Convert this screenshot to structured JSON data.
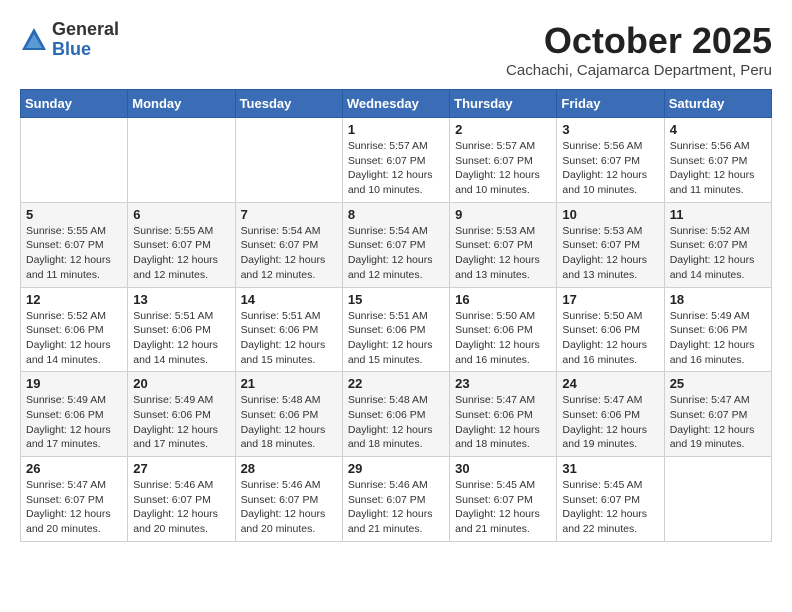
{
  "header": {
    "logo_general": "General",
    "logo_blue": "Blue",
    "month_title": "October 2025",
    "location": "Cachachi, Cajamarca Department, Peru"
  },
  "weekdays": [
    "Sunday",
    "Monday",
    "Tuesday",
    "Wednesday",
    "Thursday",
    "Friday",
    "Saturday"
  ],
  "weeks": [
    [
      {
        "day": "",
        "info": ""
      },
      {
        "day": "",
        "info": ""
      },
      {
        "day": "",
        "info": ""
      },
      {
        "day": "1",
        "info": "Sunrise: 5:57 AM\nSunset: 6:07 PM\nDaylight: 12 hours\nand 10 minutes."
      },
      {
        "day": "2",
        "info": "Sunrise: 5:57 AM\nSunset: 6:07 PM\nDaylight: 12 hours\nand 10 minutes."
      },
      {
        "day": "3",
        "info": "Sunrise: 5:56 AM\nSunset: 6:07 PM\nDaylight: 12 hours\nand 10 minutes."
      },
      {
        "day": "4",
        "info": "Sunrise: 5:56 AM\nSunset: 6:07 PM\nDaylight: 12 hours\nand 11 minutes."
      }
    ],
    [
      {
        "day": "5",
        "info": "Sunrise: 5:55 AM\nSunset: 6:07 PM\nDaylight: 12 hours\nand 11 minutes."
      },
      {
        "day": "6",
        "info": "Sunrise: 5:55 AM\nSunset: 6:07 PM\nDaylight: 12 hours\nand 12 minutes."
      },
      {
        "day": "7",
        "info": "Sunrise: 5:54 AM\nSunset: 6:07 PM\nDaylight: 12 hours\nand 12 minutes."
      },
      {
        "day": "8",
        "info": "Sunrise: 5:54 AM\nSunset: 6:07 PM\nDaylight: 12 hours\nand 12 minutes."
      },
      {
        "day": "9",
        "info": "Sunrise: 5:53 AM\nSunset: 6:07 PM\nDaylight: 12 hours\nand 13 minutes."
      },
      {
        "day": "10",
        "info": "Sunrise: 5:53 AM\nSunset: 6:07 PM\nDaylight: 12 hours\nand 13 minutes."
      },
      {
        "day": "11",
        "info": "Sunrise: 5:52 AM\nSunset: 6:07 PM\nDaylight: 12 hours\nand 14 minutes."
      }
    ],
    [
      {
        "day": "12",
        "info": "Sunrise: 5:52 AM\nSunset: 6:06 PM\nDaylight: 12 hours\nand 14 minutes."
      },
      {
        "day": "13",
        "info": "Sunrise: 5:51 AM\nSunset: 6:06 PM\nDaylight: 12 hours\nand 14 minutes."
      },
      {
        "day": "14",
        "info": "Sunrise: 5:51 AM\nSunset: 6:06 PM\nDaylight: 12 hours\nand 15 minutes."
      },
      {
        "day": "15",
        "info": "Sunrise: 5:51 AM\nSunset: 6:06 PM\nDaylight: 12 hours\nand 15 minutes."
      },
      {
        "day": "16",
        "info": "Sunrise: 5:50 AM\nSunset: 6:06 PM\nDaylight: 12 hours\nand 16 minutes."
      },
      {
        "day": "17",
        "info": "Sunrise: 5:50 AM\nSunset: 6:06 PM\nDaylight: 12 hours\nand 16 minutes."
      },
      {
        "day": "18",
        "info": "Sunrise: 5:49 AM\nSunset: 6:06 PM\nDaylight: 12 hours\nand 16 minutes."
      }
    ],
    [
      {
        "day": "19",
        "info": "Sunrise: 5:49 AM\nSunset: 6:06 PM\nDaylight: 12 hours\nand 17 minutes."
      },
      {
        "day": "20",
        "info": "Sunrise: 5:49 AM\nSunset: 6:06 PM\nDaylight: 12 hours\nand 17 minutes."
      },
      {
        "day": "21",
        "info": "Sunrise: 5:48 AM\nSunset: 6:06 PM\nDaylight: 12 hours\nand 18 minutes."
      },
      {
        "day": "22",
        "info": "Sunrise: 5:48 AM\nSunset: 6:06 PM\nDaylight: 12 hours\nand 18 minutes."
      },
      {
        "day": "23",
        "info": "Sunrise: 5:47 AM\nSunset: 6:06 PM\nDaylight: 12 hours\nand 18 minutes."
      },
      {
        "day": "24",
        "info": "Sunrise: 5:47 AM\nSunset: 6:06 PM\nDaylight: 12 hours\nand 19 minutes."
      },
      {
        "day": "25",
        "info": "Sunrise: 5:47 AM\nSunset: 6:07 PM\nDaylight: 12 hours\nand 19 minutes."
      }
    ],
    [
      {
        "day": "26",
        "info": "Sunrise: 5:47 AM\nSunset: 6:07 PM\nDaylight: 12 hours\nand 20 minutes."
      },
      {
        "day": "27",
        "info": "Sunrise: 5:46 AM\nSunset: 6:07 PM\nDaylight: 12 hours\nand 20 minutes."
      },
      {
        "day": "28",
        "info": "Sunrise: 5:46 AM\nSunset: 6:07 PM\nDaylight: 12 hours\nand 20 minutes."
      },
      {
        "day": "29",
        "info": "Sunrise: 5:46 AM\nSunset: 6:07 PM\nDaylight: 12 hours\nand 21 minutes."
      },
      {
        "day": "30",
        "info": "Sunrise: 5:45 AM\nSunset: 6:07 PM\nDaylight: 12 hours\nand 21 minutes."
      },
      {
        "day": "31",
        "info": "Sunrise: 5:45 AM\nSunset: 6:07 PM\nDaylight: 12 hours\nand 22 minutes."
      },
      {
        "day": "",
        "info": ""
      }
    ]
  ]
}
